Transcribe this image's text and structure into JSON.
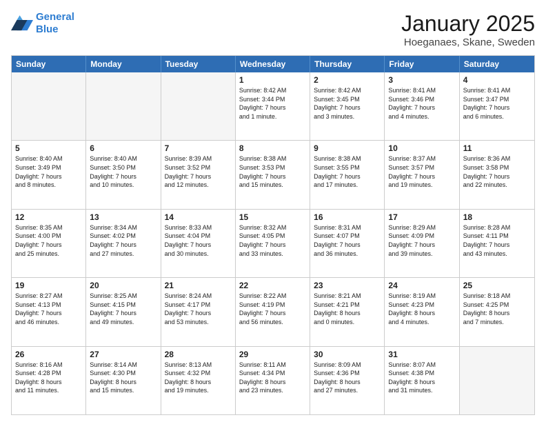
{
  "logo": {
    "line1": "General",
    "line2": "Blue"
  },
  "header": {
    "title": "January 2025",
    "subtitle": "Hoeganaes, Skane, Sweden"
  },
  "weekdays": [
    "Sunday",
    "Monday",
    "Tuesday",
    "Wednesday",
    "Thursday",
    "Friday",
    "Saturday"
  ],
  "rows": [
    [
      {
        "day": "",
        "text": "",
        "empty": true
      },
      {
        "day": "",
        "text": "",
        "empty": true
      },
      {
        "day": "",
        "text": "",
        "empty": true
      },
      {
        "day": "1",
        "text": "Sunrise: 8:42 AM\nSunset: 3:44 PM\nDaylight: 7 hours\nand 1 minute."
      },
      {
        "day": "2",
        "text": "Sunrise: 8:42 AM\nSunset: 3:45 PM\nDaylight: 7 hours\nand 3 minutes."
      },
      {
        "day": "3",
        "text": "Sunrise: 8:41 AM\nSunset: 3:46 PM\nDaylight: 7 hours\nand 4 minutes."
      },
      {
        "day": "4",
        "text": "Sunrise: 8:41 AM\nSunset: 3:47 PM\nDaylight: 7 hours\nand 6 minutes."
      }
    ],
    [
      {
        "day": "5",
        "text": "Sunrise: 8:40 AM\nSunset: 3:49 PM\nDaylight: 7 hours\nand 8 minutes."
      },
      {
        "day": "6",
        "text": "Sunrise: 8:40 AM\nSunset: 3:50 PM\nDaylight: 7 hours\nand 10 minutes."
      },
      {
        "day": "7",
        "text": "Sunrise: 8:39 AM\nSunset: 3:52 PM\nDaylight: 7 hours\nand 12 minutes."
      },
      {
        "day": "8",
        "text": "Sunrise: 8:38 AM\nSunset: 3:53 PM\nDaylight: 7 hours\nand 15 minutes."
      },
      {
        "day": "9",
        "text": "Sunrise: 8:38 AM\nSunset: 3:55 PM\nDaylight: 7 hours\nand 17 minutes."
      },
      {
        "day": "10",
        "text": "Sunrise: 8:37 AM\nSunset: 3:57 PM\nDaylight: 7 hours\nand 19 minutes."
      },
      {
        "day": "11",
        "text": "Sunrise: 8:36 AM\nSunset: 3:58 PM\nDaylight: 7 hours\nand 22 minutes."
      }
    ],
    [
      {
        "day": "12",
        "text": "Sunrise: 8:35 AM\nSunset: 4:00 PM\nDaylight: 7 hours\nand 25 minutes."
      },
      {
        "day": "13",
        "text": "Sunrise: 8:34 AM\nSunset: 4:02 PM\nDaylight: 7 hours\nand 27 minutes."
      },
      {
        "day": "14",
        "text": "Sunrise: 8:33 AM\nSunset: 4:04 PM\nDaylight: 7 hours\nand 30 minutes."
      },
      {
        "day": "15",
        "text": "Sunrise: 8:32 AM\nSunset: 4:05 PM\nDaylight: 7 hours\nand 33 minutes."
      },
      {
        "day": "16",
        "text": "Sunrise: 8:31 AM\nSunset: 4:07 PM\nDaylight: 7 hours\nand 36 minutes."
      },
      {
        "day": "17",
        "text": "Sunrise: 8:29 AM\nSunset: 4:09 PM\nDaylight: 7 hours\nand 39 minutes."
      },
      {
        "day": "18",
        "text": "Sunrise: 8:28 AM\nSunset: 4:11 PM\nDaylight: 7 hours\nand 43 minutes."
      }
    ],
    [
      {
        "day": "19",
        "text": "Sunrise: 8:27 AM\nSunset: 4:13 PM\nDaylight: 7 hours\nand 46 minutes."
      },
      {
        "day": "20",
        "text": "Sunrise: 8:25 AM\nSunset: 4:15 PM\nDaylight: 7 hours\nand 49 minutes."
      },
      {
        "day": "21",
        "text": "Sunrise: 8:24 AM\nSunset: 4:17 PM\nDaylight: 7 hours\nand 53 minutes."
      },
      {
        "day": "22",
        "text": "Sunrise: 8:22 AM\nSunset: 4:19 PM\nDaylight: 7 hours\nand 56 minutes."
      },
      {
        "day": "23",
        "text": "Sunrise: 8:21 AM\nSunset: 4:21 PM\nDaylight: 8 hours\nand 0 minutes."
      },
      {
        "day": "24",
        "text": "Sunrise: 8:19 AM\nSunset: 4:23 PM\nDaylight: 8 hours\nand 4 minutes."
      },
      {
        "day": "25",
        "text": "Sunrise: 8:18 AM\nSunset: 4:25 PM\nDaylight: 8 hours\nand 7 minutes."
      }
    ],
    [
      {
        "day": "26",
        "text": "Sunrise: 8:16 AM\nSunset: 4:28 PM\nDaylight: 8 hours\nand 11 minutes."
      },
      {
        "day": "27",
        "text": "Sunrise: 8:14 AM\nSunset: 4:30 PM\nDaylight: 8 hours\nand 15 minutes."
      },
      {
        "day": "28",
        "text": "Sunrise: 8:13 AM\nSunset: 4:32 PM\nDaylight: 8 hours\nand 19 minutes."
      },
      {
        "day": "29",
        "text": "Sunrise: 8:11 AM\nSunset: 4:34 PM\nDaylight: 8 hours\nand 23 minutes."
      },
      {
        "day": "30",
        "text": "Sunrise: 8:09 AM\nSunset: 4:36 PM\nDaylight: 8 hours\nand 27 minutes."
      },
      {
        "day": "31",
        "text": "Sunrise: 8:07 AM\nSunset: 4:38 PM\nDaylight: 8 hours\nand 31 minutes."
      },
      {
        "day": "",
        "text": "",
        "empty": true,
        "shaded": true
      }
    ]
  ]
}
